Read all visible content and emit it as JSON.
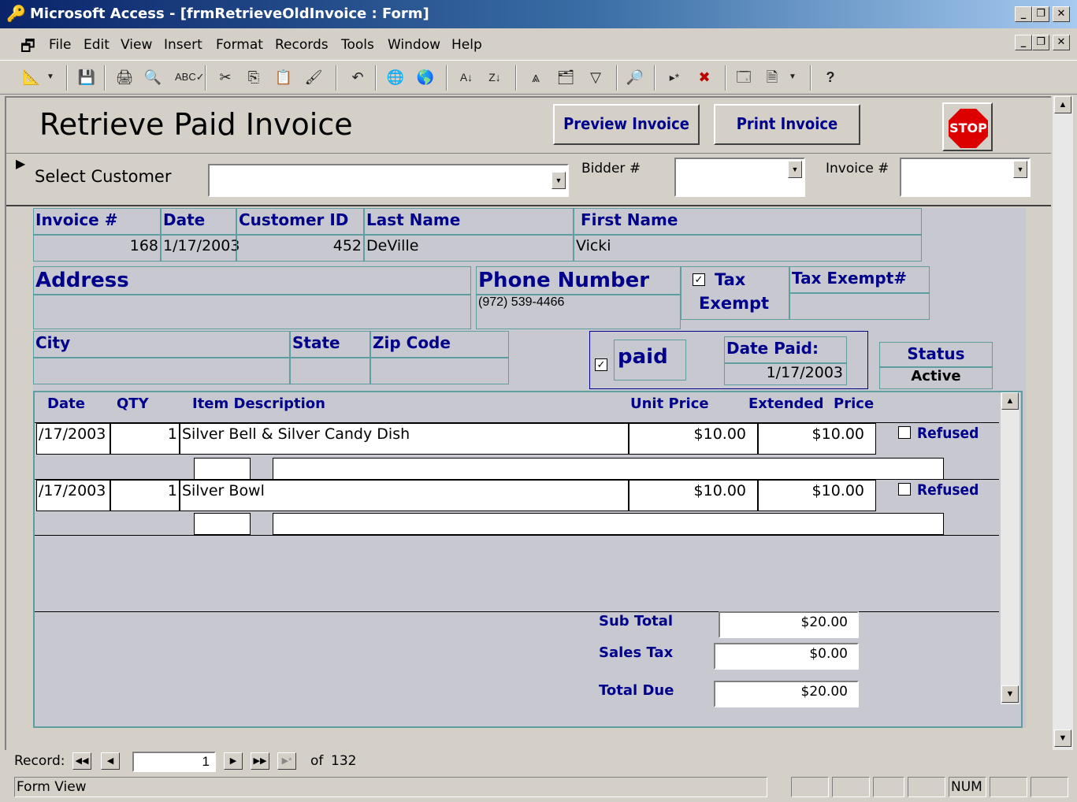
{
  "window": {
    "title": "Microsoft Access - [frmRetrieveOldInvoice : Form]"
  },
  "menu": [
    "File",
    "Edit",
    "View",
    "Insert",
    "Format",
    "Records",
    "Tools",
    "Window",
    "Help"
  ],
  "form": {
    "title": "Retrieve Paid Invoice",
    "preview_label": "Preview Invoice",
    "print_label": "Print Invoice",
    "stop_label": "STOP",
    "select_customer_label": "Select Customer",
    "bidder_label": "Bidder #",
    "invoice_filter_label": "Invoice #",
    "hdr": {
      "invoice": "Invoice #",
      "date": "Date",
      "customer_id": "Customer ID",
      "last_name": "Last Name",
      "first_name": "First Name"
    },
    "invoice_no": "168",
    "date": "1/17/2003",
    "customer_id": "452",
    "last_name": "DeVille",
    "first_name": "Vicki",
    "address_label": "Address",
    "phone_label": "Phone Number",
    "phone": "(972) 539-4466",
    "tax_exempt_label": "Tax",
    "tax_exempt_label2": "Exempt",
    "tax_exempt_no_label": "Tax Exempt#",
    "city_label": "City",
    "state_label": "State",
    "zip_label": "Zip Code",
    "paid_label": "paid",
    "date_paid_label": "Date Paid:",
    "date_paid": "1/17/2003",
    "status_label": "Status",
    "status": "Active"
  },
  "lines": {
    "headers": {
      "date": "Date",
      "qty": "QTY",
      "desc": "Item Description",
      "unit": "Unit Price",
      "ext": "Extended  Price"
    },
    "refused_label": "Refused",
    "rows": [
      {
        "date": "/17/2003",
        "qty": "1",
        "desc": "Silver Bell & Silver Candy Dish",
        "unit": "$10.00",
        "ext": "$10.00"
      },
      {
        "date": "/17/2003",
        "qty": "1",
        "desc": "Silver Bowl",
        "unit": "$10.00",
        "ext": "$10.00"
      }
    ],
    "subtotal_label": "Sub Total",
    "subtotal": "$20.00",
    "salestax_label": "Sales Tax",
    "salestax": "$0.00",
    "total_label": "Total Due",
    "total": "$20.00"
  },
  "nav": {
    "record_label": "Record:",
    "current": "1",
    "of_label": "of",
    "total": "132"
  },
  "status": {
    "left": "Form View",
    "num": "NUM"
  }
}
